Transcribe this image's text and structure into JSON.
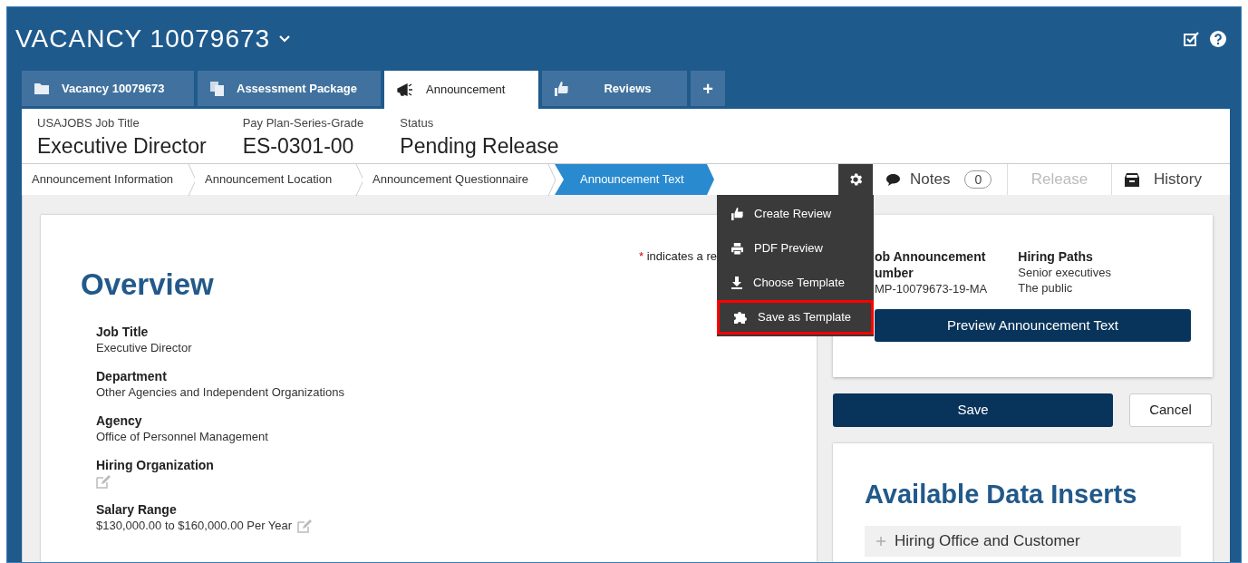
{
  "header": {
    "title": "VACANCY 10079673"
  },
  "tabs": [
    {
      "label": "Vacancy 10079673",
      "selected": false
    },
    {
      "label": "Assessment Package",
      "selected": false
    },
    {
      "label": "Announcement",
      "selected": true
    },
    {
      "label": "Reviews",
      "selected": false
    }
  ],
  "add_tab": "+",
  "summary": [
    {
      "label": "USAJOBS Job Title",
      "value": "Executive Director"
    },
    {
      "label": "Pay Plan-Series-Grade",
      "value": "ES-0301-00"
    },
    {
      "label": "Status",
      "value": "Pending Release"
    }
  ],
  "steps": [
    {
      "label": "Announcement Information",
      "selected": false
    },
    {
      "label": "Announcement Location",
      "selected": false
    },
    {
      "label": "Announcement Questionnaire",
      "selected": false
    },
    {
      "label": "Announcement Text",
      "selected": true
    }
  ],
  "actions": {
    "settings_open": true,
    "notes": {
      "label": "Notes",
      "count": "0"
    },
    "release": {
      "label": "Release",
      "disabled": true
    },
    "history": {
      "label": "History"
    }
  },
  "menu": [
    {
      "label": "Create Review",
      "highlighted": false
    },
    {
      "label": "PDF Preview",
      "highlighted": false
    },
    {
      "label": "Choose Template",
      "highlighted": false
    },
    {
      "label": "Save as Template",
      "highlighted": true
    }
  ],
  "required_note": {
    "mark": "*",
    "text": "indicates a re"
  },
  "overview": {
    "heading": "Overview",
    "fields": [
      {
        "label": "Job Title",
        "value": "Executive Director",
        "editable": false
      },
      {
        "label": "Department",
        "value": "Other Agencies and Independent Organizations",
        "editable": false
      },
      {
        "label": "Agency",
        "value": "Office of Personnel Management",
        "editable": false
      },
      {
        "label": "Hiring Organization",
        "editable": true
      },
      {
        "label": "Salary Range",
        "value": "$130,000.00 to $160,000.00 Per Year",
        "editable": true
      }
    ]
  },
  "info": [
    {
      "label_lines": [
        "ob Announcement",
        "umber"
      ],
      "values": [
        "MP-10079673-19-MA"
      ]
    },
    {
      "label_lines": [
        "Hiring Paths"
      ],
      "values": [
        "Senior executives",
        "The public"
      ]
    }
  ],
  "preview_button": "Preview Announcement Text",
  "save_button": "Save",
  "cancel_button": "Cancel",
  "inserts": {
    "heading": "Available Data Inserts",
    "items": [
      {
        "label": "Hiring Office and Customer",
        "expanded": false
      }
    ]
  }
}
